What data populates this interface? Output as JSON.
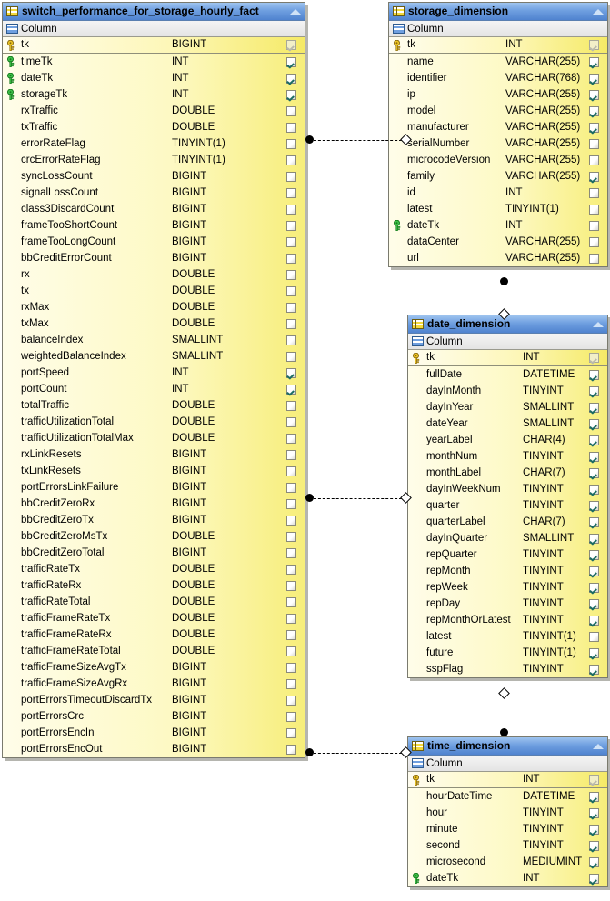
{
  "diagram": {
    "kind": "er-diagram",
    "labels": {
      "column_group": "Column",
      "collapse_icon": "collapse-triangle-icon",
      "table_icon": "table-icon",
      "pk_icon": "gold-key-icon",
      "fk_icon": "green-key-icon"
    },
    "colors": {
      "title_bar": "#4f83cf",
      "row_fill": "#fdf9c4",
      "row_fill_edge": "#f7ee7a",
      "border": "#7a7a6e",
      "pk_key": "#e8c020",
      "fk_key": "#2faa3a",
      "check": "#1b6b63"
    }
  },
  "tables": [
    {
      "id": "fact",
      "name": "switch_performance_for_storage_hourly_fact",
      "group": "Column",
      "columns": [
        {
          "name": "tk",
          "type": "BIGINT",
          "key": "pk",
          "checked": true,
          "dim": true
        },
        {
          "name": "timeTk",
          "type": "INT",
          "key": "fk",
          "checked": true
        },
        {
          "name": "dateTk",
          "type": "INT",
          "key": "fk",
          "checked": true
        },
        {
          "name": "storageTk",
          "type": "INT",
          "key": "fk",
          "checked": true
        },
        {
          "name": "rxTraffic",
          "type": "DOUBLE",
          "key": "",
          "checked": false
        },
        {
          "name": "txTraffic",
          "type": "DOUBLE",
          "key": "",
          "checked": false
        },
        {
          "name": "errorRateFlag",
          "type": "TINYINT(1)",
          "key": "",
          "checked": false
        },
        {
          "name": "crcErrorRateFlag",
          "type": "TINYINT(1)",
          "key": "",
          "checked": false
        },
        {
          "name": "syncLossCount",
          "type": "BIGINT",
          "key": "",
          "checked": false
        },
        {
          "name": "signalLossCount",
          "type": "BIGINT",
          "key": "",
          "checked": false
        },
        {
          "name": "class3DiscardCount",
          "type": "BIGINT",
          "key": "",
          "checked": false
        },
        {
          "name": "frameTooShortCount",
          "type": "BIGINT",
          "key": "",
          "checked": false
        },
        {
          "name": "frameTooLongCount",
          "type": "BIGINT",
          "key": "",
          "checked": false
        },
        {
          "name": "bbCreditErrorCount",
          "type": "BIGINT",
          "key": "",
          "checked": false
        },
        {
          "name": "rx",
          "type": "DOUBLE",
          "key": "",
          "checked": false
        },
        {
          "name": "tx",
          "type": "DOUBLE",
          "key": "",
          "checked": false
        },
        {
          "name": "rxMax",
          "type": "DOUBLE",
          "key": "",
          "checked": false
        },
        {
          "name": "txMax",
          "type": "DOUBLE",
          "key": "",
          "checked": false
        },
        {
          "name": "balanceIndex",
          "type": "SMALLINT",
          "key": "",
          "checked": false
        },
        {
          "name": "weightedBalanceIndex",
          "type": "SMALLINT",
          "key": "",
          "checked": false
        },
        {
          "name": "portSpeed",
          "type": "INT",
          "key": "",
          "checked": true
        },
        {
          "name": "portCount",
          "type": "INT",
          "key": "",
          "checked": true
        },
        {
          "name": "totalTraffic",
          "type": "DOUBLE",
          "key": "",
          "checked": false
        },
        {
          "name": "trafficUtilizationTotal",
          "type": "DOUBLE",
          "key": "",
          "checked": false
        },
        {
          "name": "trafficUtilizationTotalMax",
          "type": "DOUBLE",
          "key": "",
          "checked": false
        },
        {
          "name": "rxLinkResets",
          "type": "BIGINT",
          "key": "",
          "checked": false
        },
        {
          "name": "txLinkResets",
          "type": "BIGINT",
          "key": "",
          "checked": false
        },
        {
          "name": "portErrorsLinkFailure",
          "type": "BIGINT",
          "key": "",
          "checked": false
        },
        {
          "name": "bbCreditZeroRx",
          "type": "BIGINT",
          "key": "",
          "checked": false
        },
        {
          "name": "bbCreditZeroTx",
          "type": "BIGINT",
          "key": "",
          "checked": false
        },
        {
          "name": "bbCreditZeroMsTx",
          "type": "DOUBLE",
          "key": "",
          "checked": false
        },
        {
          "name": "bbCreditZeroTotal",
          "type": "BIGINT",
          "key": "",
          "checked": false
        },
        {
          "name": "trafficRateTx",
          "type": "DOUBLE",
          "key": "",
          "checked": false
        },
        {
          "name": "trafficRateRx",
          "type": "DOUBLE",
          "key": "",
          "checked": false
        },
        {
          "name": "trafficRateTotal",
          "type": "DOUBLE",
          "key": "",
          "checked": false
        },
        {
          "name": "trafficFrameRateTx",
          "type": "DOUBLE",
          "key": "",
          "checked": false
        },
        {
          "name": "trafficFrameRateRx",
          "type": "DOUBLE",
          "key": "",
          "checked": false
        },
        {
          "name": "trafficFrameRateTotal",
          "type": "DOUBLE",
          "key": "",
          "checked": false
        },
        {
          "name": "trafficFrameSizeAvgTx",
          "type": "BIGINT",
          "key": "",
          "checked": false
        },
        {
          "name": "trafficFrameSizeAvgRx",
          "type": "BIGINT",
          "key": "",
          "checked": false
        },
        {
          "name": "portErrorsTimeoutDiscardTx",
          "type": "BIGINT",
          "key": "",
          "checked": false
        },
        {
          "name": "portErrorsCrc",
          "type": "BIGINT",
          "key": "",
          "checked": false
        },
        {
          "name": "portErrorsEncIn",
          "type": "BIGINT",
          "key": "",
          "checked": false
        },
        {
          "name": "portErrorsEncOut",
          "type": "BIGINT",
          "key": "",
          "checked": false
        }
      ]
    },
    {
      "id": "storage",
      "name": "storage_dimension",
      "group": "Column",
      "columns": [
        {
          "name": "tk",
          "type": "INT",
          "key": "pk",
          "checked": true,
          "dim": true
        },
        {
          "name": "name",
          "type": "VARCHAR(255)",
          "key": "",
          "checked": true
        },
        {
          "name": "identifier",
          "type": "VARCHAR(768)",
          "key": "",
          "checked": true
        },
        {
          "name": "ip",
          "type": "VARCHAR(255)",
          "key": "",
          "checked": true
        },
        {
          "name": "model",
          "type": "VARCHAR(255)",
          "key": "",
          "checked": true
        },
        {
          "name": "manufacturer",
          "type": "VARCHAR(255)",
          "key": "",
          "checked": true
        },
        {
          "name": "serialNumber",
          "type": "VARCHAR(255)",
          "key": "",
          "checked": false
        },
        {
          "name": "microcodeVersion",
          "type": "VARCHAR(255)",
          "key": "",
          "checked": false
        },
        {
          "name": "family",
          "type": "VARCHAR(255)",
          "key": "",
          "checked": true
        },
        {
          "name": "id",
          "type": "INT",
          "key": "",
          "checked": false
        },
        {
          "name": "latest",
          "type": "TINYINT(1)",
          "key": "",
          "checked": false
        },
        {
          "name": "dateTk",
          "type": "INT",
          "key": "fk",
          "checked": false
        },
        {
          "name": "dataCenter",
          "type": "VARCHAR(255)",
          "key": "",
          "checked": false
        },
        {
          "name": "url",
          "type": "VARCHAR(255)",
          "key": "",
          "checked": false
        }
      ]
    },
    {
      "id": "date",
      "name": "date_dimension",
      "group": "Column",
      "columns": [
        {
          "name": "tk",
          "type": "INT",
          "key": "pk",
          "checked": true,
          "dim": true
        },
        {
          "name": "fullDate",
          "type": "DATETIME",
          "key": "",
          "checked": true
        },
        {
          "name": "dayInMonth",
          "type": "TINYINT",
          "key": "",
          "checked": true
        },
        {
          "name": "dayInYear",
          "type": "SMALLINT",
          "key": "",
          "checked": true
        },
        {
          "name": "dateYear",
          "type": "SMALLINT",
          "key": "",
          "checked": true
        },
        {
          "name": "yearLabel",
          "type": "CHAR(4)",
          "key": "",
          "checked": true
        },
        {
          "name": "monthNum",
          "type": "TINYINT",
          "key": "",
          "checked": true
        },
        {
          "name": "monthLabel",
          "type": "CHAR(7)",
          "key": "",
          "checked": true
        },
        {
          "name": "dayInWeekNum",
          "type": "TINYINT",
          "key": "",
          "checked": true
        },
        {
          "name": "quarter",
          "type": "TINYINT",
          "key": "",
          "checked": true
        },
        {
          "name": "quarterLabel",
          "type": "CHAR(7)",
          "key": "",
          "checked": true
        },
        {
          "name": "dayInQuarter",
          "type": "SMALLINT",
          "key": "",
          "checked": true
        },
        {
          "name": "repQuarter",
          "type": "TINYINT",
          "key": "",
          "checked": true
        },
        {
          "name": "repMonth",
          "type": "TINYINT",
          "key": "",
          "checked": true
        },
        {
          "name": "repWeek",
          "type": "TINYINT",
          "key": "",
          "checked": true
        },
        {
          "name": "repDay",
          "type": "TINYINT",
          "key": "",
          "checked": true
        },
        {
          "name": "repMonthOrLatest",
          "type": "TINYINT",
          "key": "",
          "checked": true
        },
        {
          "name": "latest",
          "type": "TINYINT(1)",
          "key": "",
          "checked": false
        },
        {
          "name": "future",
          "type": "TINYINT(1)",
          "key": "",
          "checked": true
        },
        {
          "name": "sspFlag",
          "type": "TINYINT",
          "key": "",
          "checked": true
        }
      ]
    },
    {
      "id": "time",
      "name": "time_dimension",
      "group": "Column",
      "columns": [
        {
          "name": "tk",
          "type": "INT",
          "key": "pk",
          "checked": true,
          "dim": true
        },
        {
          "name": "hourDateTime",
          "type": "DATETIME",
          "key": "",
          "checked": true
        },
        {
          "name": "hour",
          "type": "TINYINT",
          "key": "",
          "checked": true
        },
        {
          "name": "minute",
          "type": "TINYINT",
          "key": "",
          "checked": true
        },
        {
          "name": "second",
          "type": "TINYINT",
          "key": "",
          "checked": true
        },
        {
          "name": "microsecond",
          "type": "MEDIUMINT",
          "key": "",
          "checked": true
        },
        {
          "name": "dateTk",
          "type": "INT",
          "key": "fk",
          "checked": true
        }
      ]
    }
  ],
  "relationships": [
    {
      "id": "fact-storage",
      "from": "fact",
      "to": "storage",
      "orientation": "horizontal",
      "from_end": "dot",
      "to_end": "diamond"
    },
    {
      "id": "fact-date",
      "from": "fact",
      "to": "date",
      "orientation": "horizontal",
      "from_end": "dot",
      "to_end": "diamond"
    },
    {
      "id": "fact-time",
      "from": "fact",
      "to": "time",
      "orientation": "horizontal",
      "from_end": "dot",
      "to_end": "diamond"
    },
    {
      "id": "storage-date",
      "from": "storage",
      "to": "date",
      "orientation": "vertical",
      "from_end": "dot",
      "to_end": "diamond"
    },
    {
      "id": "date-time",
      "from": "date",
      "to": "time",
      "orientation": "vertical",
      "from_end": "diamond",
      "to_end": "dot"
    }
  ]
}
